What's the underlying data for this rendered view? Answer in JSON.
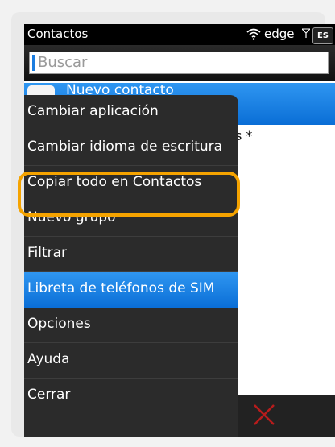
{
  "status": {
    "title": "Contactos",
    "network": "edge",
    "lang": "ES"
  },
  "search": {
    "placeholder": "Buscar"
  },
  "list": {
    "new_contact": "Nuevo contacto",
    "partial_text": "s *"
  },
  "menu": {
    "items": [
      {
        "label": "Cambiar aplicación"
      },
      {
        "label": "Cambiar idioma de escritura"
      },
      {
        "label": "Copiar todo en Contactos"
      },
      {
        "label": "Nuevo grupo"
      },
      {
        "label": "Filtrar"
      },
      {
        "label": "Libreta de teléfonos de SIM"
      },
      {
        "label": "Opciones"
      },
      {
        "label": "Ayuda"
      },
      {
        "label": "Cerrar"
      }
    ],
    "selected_index": 5,
    "highlighted_index": 2
  },
  "colors": {
    "accent": "#1b7de0",
    "highlight": "#f5a300",
    "menu_bg": "#2b2b2b",
    "close": "#c62828"
  },
  "icons": {
    "wifi": "wifi-icon",
    "signal": "signal-icon",
    "close": "close-x-icon"
  }
}
